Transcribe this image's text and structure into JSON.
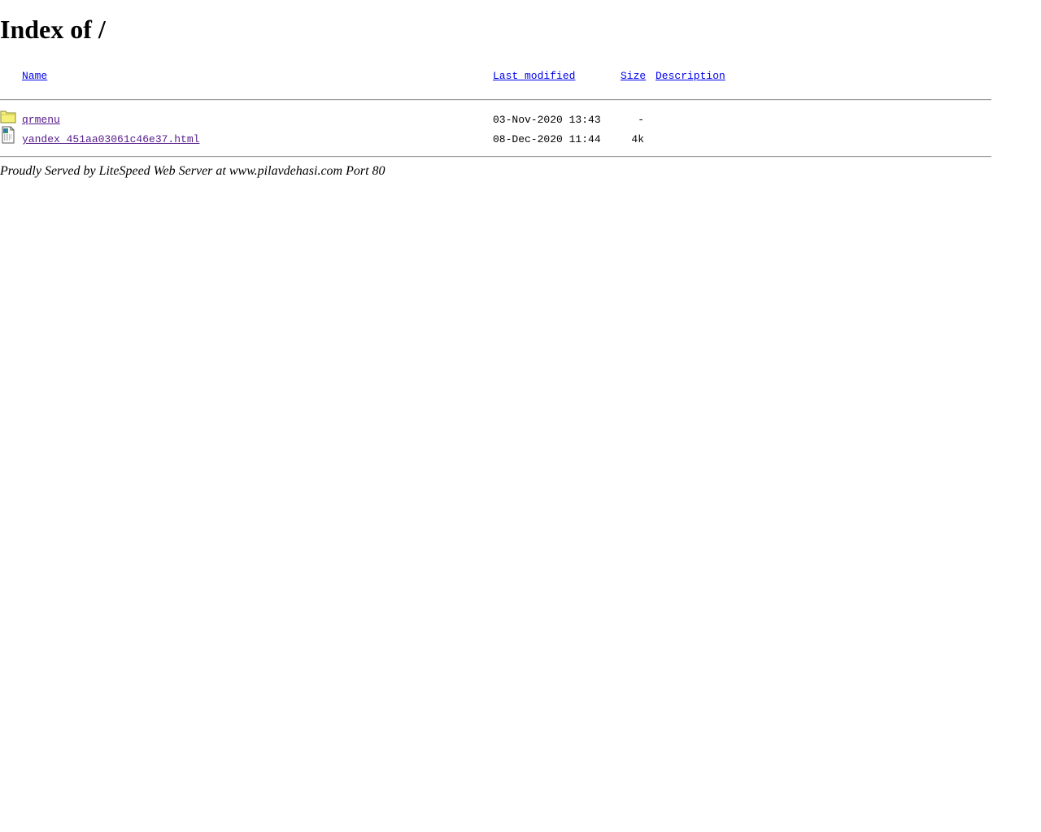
{
  "page": {
    "title": "Index of /"
  },
  "table": {
    "headers": {
      "name": "Name",
      "last_modified": "Last modified",
      "size": "Size",
      "description": "Description"
    },
    "rows": [
      {
        "icon": "folder-icon",
        "name": "qrmenu",
        "last_modified": "03-Nov-2020 13:43",
        "size": "-",
        "description": ""
      },
      {
        "icon": "html-file-icon",
        "name": "yandex_451aa03061c46e37.html",
        "last_modified": "08-Dec-2020 11:44",
        "size": "4k",
        "description": ""
      }
    ]
  },
  "footer": {
    "text": "Proudly Served by LiteSpeed Web Server at www.pilavdehasi.com Port 80"
  },
  "colors": {
    "link": "#0000ee",
    "visited_link": "#551a8b",
    "folder": "#f5f07a",
    "rule": "#9a9a9a"
  }
}
